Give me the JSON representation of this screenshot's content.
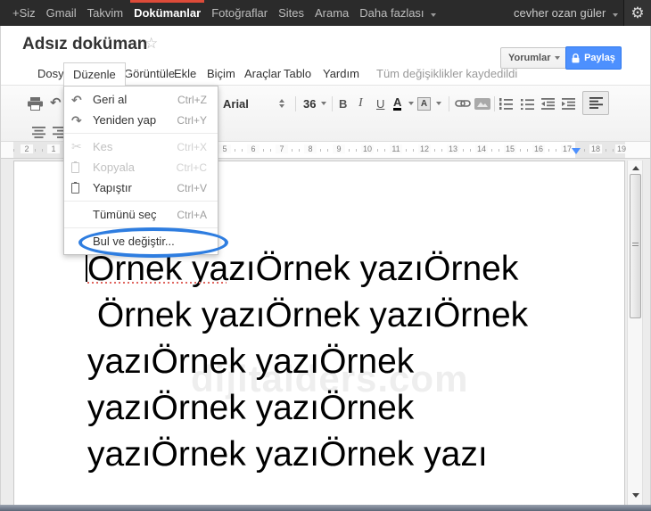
{
  "topbar": {
    "links": [
      "+Siz",
      "Gmail",
      "Takvim",
      "Dokümanlar",
      "Fotoğraflar",
      "Sites",
      "Arama",
      "Daha fazlası"
    ],
    "active_link": "Dokümanlar",
    "user_name": "cevher ozan güler"
  },
  "icons": {
    "gear": "⚙",
    "star": "☆",
    "undo": "↶",
    "redo": "↷",
    "scissors": "✂"
  },
  "header": {
    "title": "Adsız doküman",
    "comments_button": "Yorumlar",
    "share_button": "Paylaş"
  },
  "menubar": {
    "items": [
      "Dosya",
      "Düzenle",
      "Görüntüle",
      "Ekle",
      "Biçim",
      "Araçlar",
      "Tablo",
      "Yardım"
    ],
    "open_item": "Düzenle",
    "status": "Tüm değişiklikler kaydedildi"
  },
  "toolbar": {
    "font_name": "Arial",
    "font_size": "36",
    "bold_label": "B",
    "italic_label": "I",
    "underline_label": "U",
    "text_color_label": "A",
    "highlight_label": "A"
  },
  "edit_menu": {
    "items": [
      {
        "label": "Geri al",
        "shortcut": "Ctrl+Z",
        "disabled": false
      },
      {
        "label": "Yeniden yap",
        "shortcut": "Ctrl+Y",
        "disabled": false
      },
      {
        "label": "Kes",
        "shortcut": "Ctrl+X",
        "disabled": true
      },
      {
        "label": "Kopyala",
        "shortcut": "Ctrl+C",
        "disabled": true
      },
      {
        "label": "Yapıştır",
        "shortcut": "Ctrl+V",
        "disabled": false
      },
      {
        "label": "Tümünü seç",
        "shortcut": "Ctrl+A",
        "disabled": false
      },
      {
        "label": "Bul ve değiştir...",
        "shortcut": "",
        "disabled": false,
        "highlighted": true
      }
    ]
  },
  "ruler": {
    "left_numbers": [
      "2",
      "1"
    ],
    "numbers": [
      "5",
      "6",
      "7",
      "8",
      "9",
      "10",
      "11",
      "12",
      "13",
      "14",
      "15",
      "16",
      "17",
      "18",
      "19"
    ]
  },
  "document": {
    "lines": [
      "Örnek yazıÖrnek yazıÖrnek",
      " Örnek yazıÖrnek yazıÖrnek",
      "yazıÖrnek yazıÖrnek",
      "yazıÖrnek yazıÖrnek",
      "yazıÖrnek yazıÖrnek yazı"
    ],
    "watermark": "dijitalders.com"
  },
  "colors": {
    "share_blue": "#4d90fe",
    "active_tab_red": "#dd4b39",
    "annotation_blue": "#2e7de0"
  }
}
